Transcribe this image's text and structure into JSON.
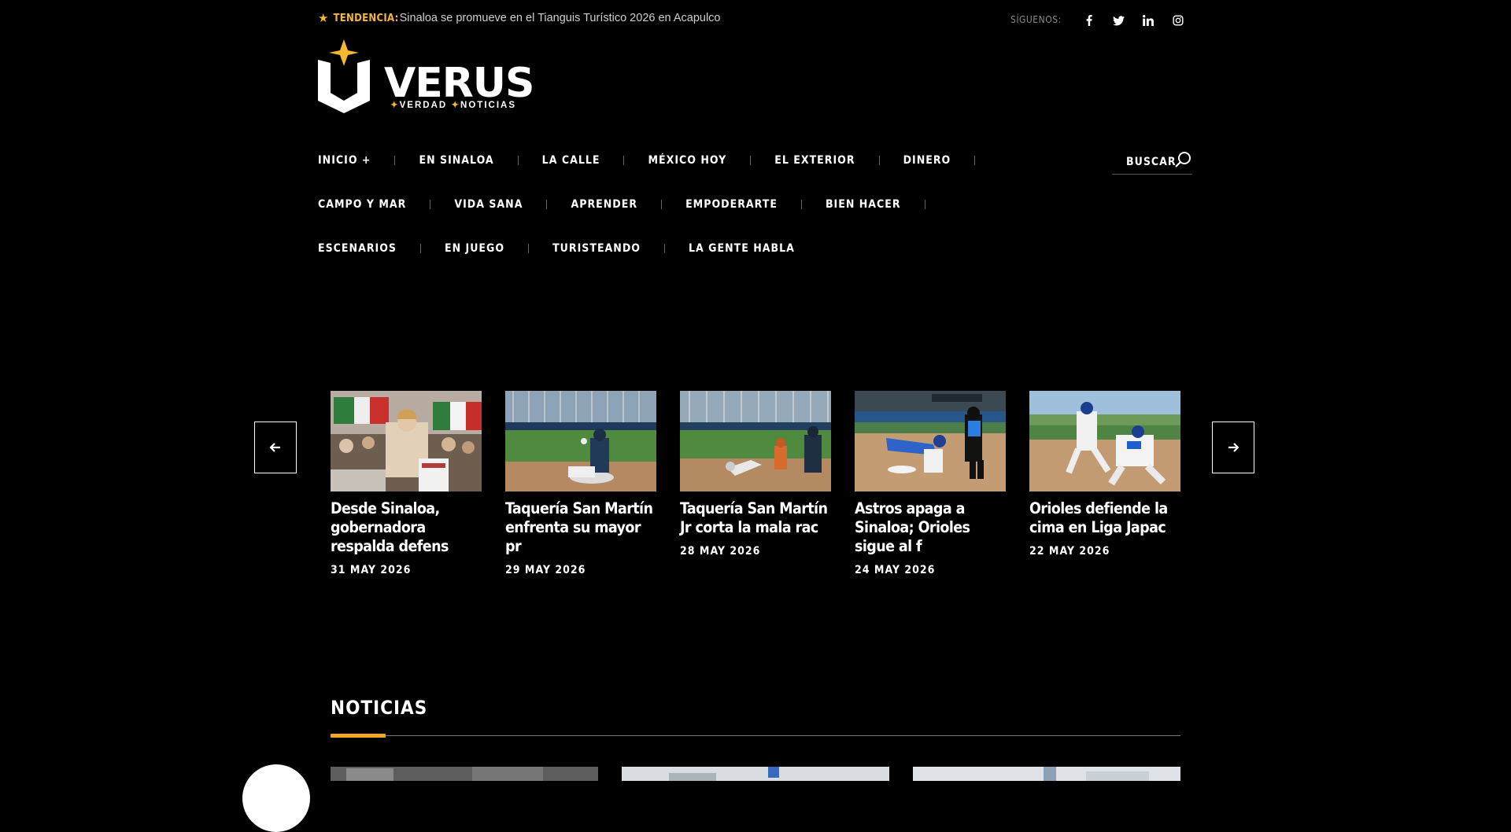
{
  "topbar": {
    "trend_label": "TENDENCIA:",
    "trend_headline": "Sinaloa se promueve en el Tianguis Turístico 2026 en Acapulco",
    "follow_label": "SÍGUENOS:",
    "social_icons": [
      "facebook-icon",
      "twitter-icon",
      "linkedin-icon",
      "instagram-icon"
    ]
  },
  "logo": {
    "word": "VERUS",
    "tag_part1": "VERDAD",
    "tag_part2": "NOTICIAS",
    "accent": "#f5b82e"
  },
  "nav": {
    "row1": [
      "INICIO +",
      "EN SINALOA",
      "LA CALLE",
      "MÉXICO HOY",
      "EL EXTERIOR",
      "DINERO"
    ],
    "row2": [
      "CAMPO Y MAR",
      "VIDA SANA",
      "APRENDER",
      "EMPODERARTE",
      "BIEN HACER"
    ],
    "row3": [
      "ESCENARIOS",
      "EN JUEGO",
      "TURISTEANDO",
      "LA GENTE HABLA"
    ],
    "search_label": "BUSCAR"
  },
  "carousel": {
    "cards": [
      {
        "title": "Desde Sinaloa, gobernadora respalda defens",
        "date": "31 MAY 2026"
      },
      {
        "title": "Taquería San Martín enfrenta su mayor pr",
        "date": "29 MAY 2026"
      },
      {
        "title": "Taquería San Martín Jr corta la mala rac",
        "date": "28 MAY 2026"
      },
      {
        "title": "Astros apaga a Sinaloa; Orioles sigue al f",
        "date": "24 MAY 2026"
      },
      {
        "title": "Orioles defiende la cima en Liga Japac",
        "date": "22 MAY 2026"
      }
    ]
  },
  "news": {
    "section_title": "NOTICIAS",
    "accent": "#f5a623"
  }
}
